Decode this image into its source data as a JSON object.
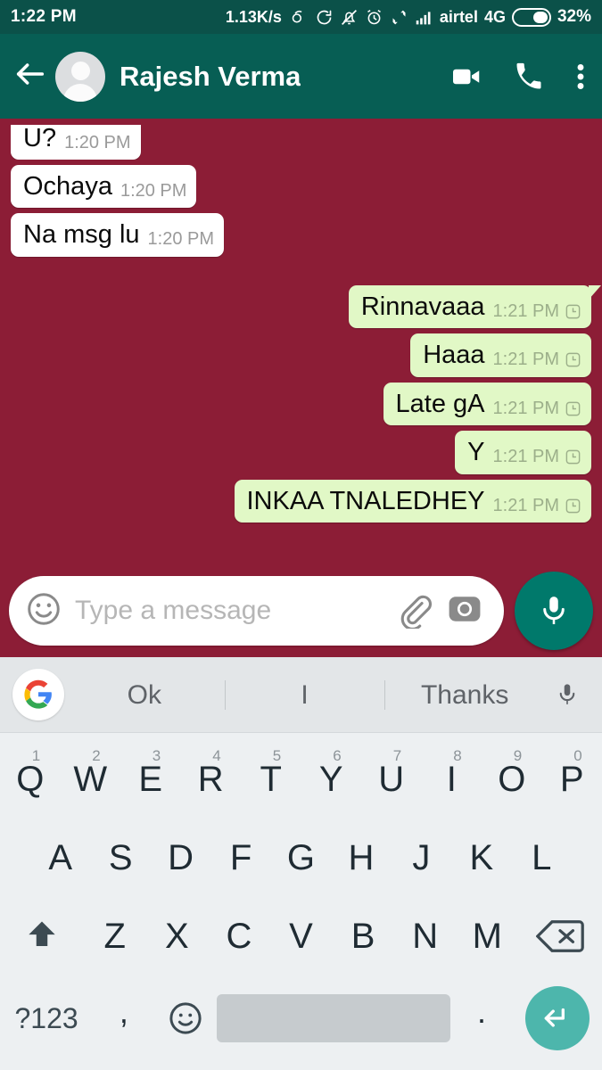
{
  "status_bar": {
    "time": "1:22 PM",
    "network_speed": "1.13K/s",
    "carrier": "airtel",
    "network_type": "4G",
    "battery_percent": "32%",
    "icons": [
      "rotate-icon",
      "sync-icon",
      "bell-muted-icon",
      "alarm-icon",
      "data-transfer-icon",
      "signal-bars-icon",
      "battery-icon"
    ]
  },
  "app_bar": {
    "contact_name": "Rajesh Verma",
    "back_label": "back-arrow-icon",
    "video_call_label": "video-call-icon",
    "voice_call_label": "phone-call-icon",
    "menu_label": "overflow-menu-icon"
  },
  "chat": {
    "background_color": "#8C1D36",
    "incoming_bubble_color": "#FFFFFF",
    "outgoing_bubble_color": "#E1F8C6",
    "messages": [
      {
        "text": "U?",
        "time": "1:20 PM",
        "direction": "in",
        "clipped": true
      },
      {
        "text": "Ochaya",
        "time": "1:20 PM",
        "direction": "in"
      },
      {
        "text": "Na msg lu",
        "time": "1:20 PM",
        "direction": "in"
      },
      {
        "text": "Rinnavaaa",
        "time": "1:21 PM",
        "direction": "out",
        "status": "pending-clock-icon"
      },
      {
        "text": "Haaa",
        "time": "1:21 PM",
        "direction": "out",
        "status": "pending-clock-icon"
      },
      {
        "text": "Late gA",
        "time": "1:21 PM",
        "direction": "out",
        "status": "pending-clock-icon"
      },
      {
        "text": "Y",
        "time": "1:21 PM",
        "direction": "out",
        "status": "pending-clock-icon"
      },
      {
        "text": "INKAA TNALEDHEY",
        "time": "1:21 PM",
        "direction": "out",
        "status": "pending-clock-icon"
      }
    ]
  },
  "input_bar": {
    "placeholder": "Type a message",
    "emoji_label": "emoji-icon",
    "attach_label": "attach-paperclip-icon",
    "camera_label": "camera-icon",
    "mic_label": "microphone-button",
    "mic_color": "#00796B"
  },
  "keyboard": {
    "suggestions": [
      "Ok",
      "I",
      "Thanks"
    ],
    "google_logo_label": "google-logo-icon",
    "suggestion_mic_label": "voice-input-icon",
    "row1": [
      {
        "letter": "Q",
        "num": "1"
      },
      {
        "letter": "W",
        "num": "2"
      },
      {
        "letter": "E",
        "num": "3"
      },
      {
        "letter": "R",
        "num": "4"
      },
      {
        "letter": "T",
        "num": "5"
      },
      {
        "letter": "Y",
        "num": "6"
      },
      {
        "letter": "U",
        "num": "7"
      },
      {
        "letter": "I",
        "num": "8"
      },
      {
        "letter": "O",
        "num": "9"
      },
      {
        "letter": "P",
        "num": "0"
      }
    ],
    "row2": [
      "A",
      "S",
      "D",
      "F",
      "G",
      "H",
      "J",
      "K",
      "L"
    ],
    "row3": [
      "Z",
      "X",
      "C",
      "V",
      "B",
      "N",
      "M"
    ],
    "shift_label": "shift-key-icon",
    "backspace_label": "backspace-key-icon",
    "symbols_key": "?123",
    "comma_key": ",",
    "emoji_key_label": "emoji-key-icon",
    "space_key_label": "space-bar",
    "period_key": ".",
    "enter_key_label": "enter-key-icon",
    "enter_color": "#4DB6AC"
  }
}
